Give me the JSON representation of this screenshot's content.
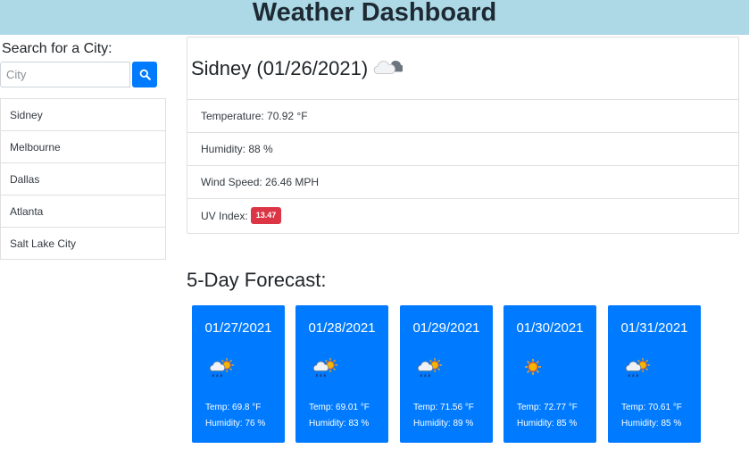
{
  "header": {
    "title": "Weather Dashboard"
  },
  "search": {
    "label": "Search for a City:",
    "placeholder": "City",
    "button_icon": "search-icon"
  },
  "cities": [
    "Sidney",
    "Melbourne",
    "Dallas",
    "Atlanta",
    "Salt Lake City"
  ],
  "current": {
    "title": "Sidney (01/26/2021)",
    "icon": "partly-cloudy-icon",
    "temperature": "Temperature: 70.92 °F",
    "humidity": "Humidity: 88 %",
    "wind": "Wind Speed: 26.46 MPH",
    "uv_label": "UV Index:",
    "uv_value": "13.47",
    "uv_color": "#dc3545"
  },
  "forecast": {
    "title": "5-Day Forecast:",
    "card_color": "#007bff",
    "days": [
      {
        "date": "01/27/2021",
        "icon": "sun-rain-icon",
        "temp": "Temp: 69.8 °F",
        "humidity": "Humidity: 76 %"
      },
      {
        "date": "01/28/2021",
        "icon": "sun-rain-icon",
        "temp": "Temp: 69.01 °F",
        "humidity": "Humidity: 83 %"
      },
      {
        "date": "01/29/2021",
        "icon": "sun-rain-icon",
        "temp": "Temp: 71.56 °F",
        "humidity": "Humidity: 89 %"
      },
      {
        "date": "01/30/2021",
        "icon": "sun-icon",
        "temp": "Temp: 72.77 °F",
        "humidity": "Humidity: 85 %"
      },
      {
        "date": "01/31/2021",
        "icon": "sun-rain-icon",
        "temp": "Temp: 70.61 °F",
        "humidity": "Humidity: 85 %"
      }
    ]
  }
}
